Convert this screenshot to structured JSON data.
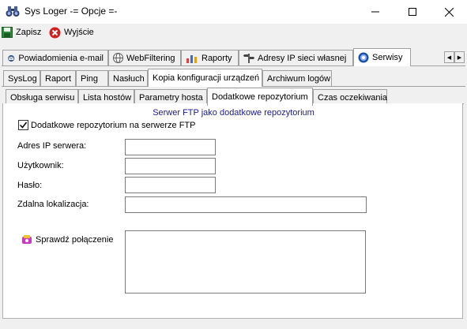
{
  "window": {
    "title": "Sys Loger -= Opcje =-",
    "icon": "binoculars-icon"
  },
  "toolbar": {
    "save_label": "Zapisz",
    "exit_label": "Wyjście"
  },
  "main_tabs": [
    {
      "label": "Powiadomienia e-mail",
      "icon": "email-icon"
    },
    {
      "label": "WebFiltering",
      "icon": "globe-icon"
    },
    {
      "label": "Raporty",
      "icon": "chart-icon"
    },
    {
      "label": "Adresy IP sieci własnej",
      "icon": "signpost-icon"
    },
    {
      "label": "Serwisy",
      "icon": "services-icon",
      "active": true
    }
  ],
  "service_tabs": [
    {
      "label": "SysLog"
    },
    {
      "label": "Raport"
    },
    {
      "label": "Ping"
    },
    {
      "label": "Nasłuch"
    },
    {
      "label": "Kopia konfiguracji urządzeń",
      "active": true
    },
    {
      "label": "Archiwum logów"
    }
  ],
  "backup_tabs": [
    {
      "label": "Obsługa serwisu"
    },
    {
      "label": "Lista hostów"
    },
    {
      "label": "Parametry hosta"
    },
    {
      "label": "Dodatkowe repozytorium",
      "active": true
    },
    {
      "label": "Czas oczekiwania"
    }
  ],
  "form": {
    "section_title": "Serwer FTP jako dodatkowe repozytorium",
    "checkbox_label": "Dodatkowe repozytorium na serwerze FTP",
    "checkbox_checked": true,
    "server_ip_label": "Adres IP serwera:",
    "server_ip_value": "",
    "user_label": "Użytkownik:",
    "user_value": "",
    "password_label": "Hasło:",
    "password_value": "",
    "remote_location_label": "Zdalna lokalizacja:",
    "remote_location_value": "",
    "check_connection_label": "Sprawdź połączenie",
    "result_text": ""
  },
  "colors": {
    "section_title": "#1a1a8c",
    "panel_bg": "#ffffff",
    "window_bg": "#f0f0f0"
  }
}
